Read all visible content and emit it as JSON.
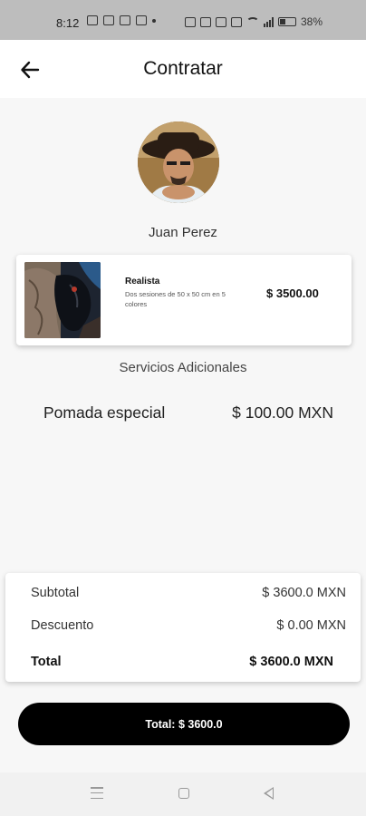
{
  "status_bar": {
    "time": "8:12",
    "battery_percent": "38%",
    "icons": [
      "notification-icon",
      "notification-icon",
      "mail-icon",
      "carrier-icon",
      "dot-icon",
      "nfc-icon",
      "mute-icon",
      "bluetooth-icon",
      "location-icon",
      "wifi-icon",
      "signal-icon",
      "battery-icon"
    ]
  },
  "header": {
    "title": "Contratar",
    "back_icon": "arrow-left-icon"
  },
  "artist": {
    "name": "Juan Perez"
  },
  "service": {
    "title": "Realista",
    "description": "Dos sesiones de 50 x 50 cm en 5 colores",
    "price": "$ 3500.00"
  },
  "additional": {
    "section_label": "Servicios Adicionales",
    "items": [
      {
        "name": "Pomada especial",
        "price": "$ 100.00 MXN"
      }
    ]
  },
  "summary": {
    "subtotal_label": "Subtotal",
    "subtotal_value": "$ 3600.0 MXN",
    "discount_label": "Descuento",
    "discount_value": "$ 0.00 MXN",
    "total_label": "Total",
    "total_value": "$ 3600.0 MXN"
  },
  "pay_button": {
    "label": "Total: $ 3600.0"
  },
  "nav_bar": {
    "icons": [
      "menu-icon",
      "home-icon",
      "back-icon"
    ]
  },
  "colors": {
    "primary_button": "#000000",
    "status_bar": "#bdbdbd",
    "background": "#f7f7f7"
  }
}
